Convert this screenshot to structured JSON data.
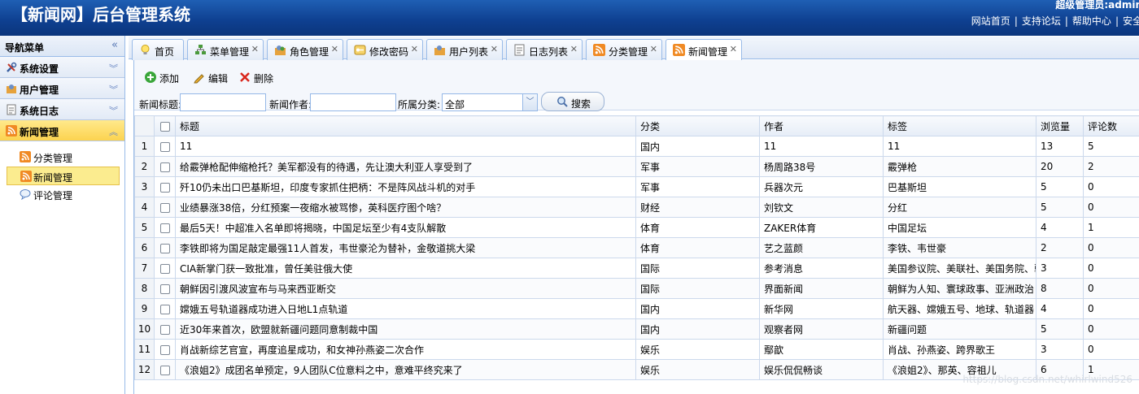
{
  "header": {
    "title": "【新闻网】后台管理系统",
    "user": "超级管理员:admin，欢迎",
    "links": [
      "网站首页",
      "支持论坛",
      "帮助中心",
      "安全"
    ]
  },
  "sidebar": {
    "title": "导航菜单",
    "groups": [
      {
        "label": "系统设置",
        "icon": "tools-icon"
      },
      {
        "label": "用户管理",
        "icon": "users-icon"
      },
      {
        "label": "系统日志",
        "icon": "log-icon"
      },
      {
        "label": "新闻管理",
        "icon": "rss-icon"
      }
    ],
    "sub_items": [
      {
        "label": "分类管理",
        "icon": "rss-icon"
      },
      {
        "label": "新闻管理",
        "icon": "rss-icon"
      },
      {
        "label": "评论管理",
        "icon": "comment-icon"
      }
    ]
  },
  "tabs": [
    {
      "label": "首页",
      "icon": "bulb-icon"
    },
    {
      "label": "菜单管理",
      "icon": "tree-icon"
    },
    {
      "label": "角色管理",
      "icon": "role-icon"
    },
    {
      "label": "修改密码",
      "icon": "key-icon"
    },
    {
      "label": "用户列表",
      "icon": "user-list-icon"
    },
    {
      "label": "日志列表",
      "icon": "doc-icon"
    },
    {
      "label": "分类管理",
      "icon": "rss-icon"
    },
    {
      "label": "新闻管理",
      "icon": "rss-icon"
    }
  ],
  "toolbar": {
    "add": "添加",
    "edit": "编辑",
    "delete": "删除"
  },
  "filters": {
    "title_label": "新闻标题:",
    "author_label": "新闻作者:",
    "category_label": "所属分类:",
    "category_value": "全部",
    "search_label": "搜索"
  },
  "table": {
    "columns": [
      "标题",
      "分类",
      "作者",
      "标签",
      "浏览量",
      "评论数"
    ],
    "rows": [
      [
        "1",
        "11",
        "国内",
        "11",
        "11",
        "13",
        "5"
      ],
      [
        "2",
        "给霰弹枪配伸缩枪托？美军都没有的待遇，先让澳大利亚人享受到了",
        "军事",
        "杨周路38号",
        "霰弹枪",
        "20",
        "2"
      ],
      [
        "3",
        "歼10仍未出口巴基斯坦，印度专家抓住把柄：不是阵风战斗机的对手",
        "军事",
        "兵器次元",
        "巴基斯坦",
        "5",
        "0"
      ],
      [
        "4",
        "业绩暴涨38倍，分红预案一夜缩水被骂惨，英科医疗图个啥？",
        "财经",
        "刘钦文",
        "分红",
        "5",
        "0"
      ],
      [
        "5",
        "最后5天！中超准入名单即将揭晓，中国足坛至少有4支队解散",
        "体育",
        "ZAKER体育",
        "中国足坛",
        "4",
        "1"
      ],
      [
        "6",
        "李铁即将为国足敲定最强11人首发，韦世豪沦为替补，金敬道挑大梁",
        "体育",
        "艺之蓝颜",
        "李铁、韦世豪",
        "2",
        "0"
      ],
      [
        "7",
        "CIA新掌门获一致批准，曾任美驻俄大使",
        "国际",
        "参考消息",
        "美国参议院、美联社、美国务院、驻",
        "3",
        "0"
      ],
      [
        "8",
        "朝鲜因引渡风波宣布与马来西亚断交",
        "国际",
        "界面新闻",
        "朝鲜为人知、寰球政事、亚洲政治",
        "8",
        "0"
      ],
      [
        "9",
        "嫦娥五号轨道器成功进入日地L1点轨道",
        "国内",
        "新华网",
        "航天器、嫦娥五号、地球、轨道器",
        "4",
        "0"
      ],
      [
        "10",
        "近30年来首次，欧盟就新疆问题同意制裁中国",
        "国内",
        "观察者网",
        "新疆问题",
        "5",
        "0"
      ],
      [
        "11",
        "肖战新综艺官宣，再度追星成功，和女神孙燕姿二次合作",
        "娱乐",
        "鄢歆",
        "肖战、孙燕姿、跨界歌王",
        "3",
        "0"
      ],
      [
        "12",
        "《浪姐2》成团名单预定，9人团队C位意料之中，意难平终究来了",
        "娱乐",
        "娱乐侃侃畅谈",
        "《浪姐2》、那英、容祖儿",
        "6",
        "1"
      ]
    ]
  },
  "watermark": "https://blog.csdn.net/whirlwind526",
  "colors": {
    "header": "#0e3f8f",
    "border": "#99bbe8",
    "selected": "#fbec8f"
  }
}
